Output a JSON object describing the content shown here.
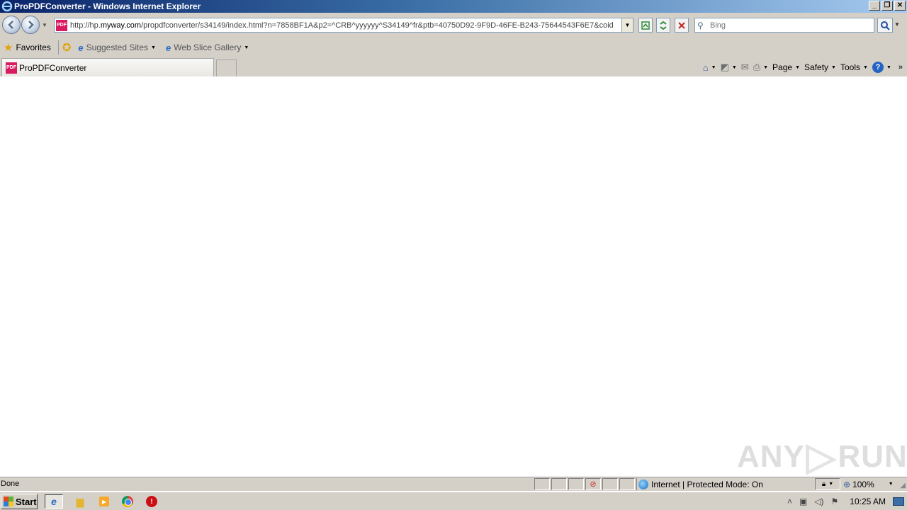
{
  "window": {
    "title": "ProPDFConverter - Windows Internet Explorer",
    "controls": [
      "minimize",
      "restore",
      "close"
    ]
  },
  "address_bar": {
    "url_prefix": "http://hp.",
    "url_domain": "myway.com",
    "url_rest": "/propdfconverter/s34149/index.html?n=7858BF1A&p2=^CRB^yyyyyy^S34149^fr&ptb=40750D92-9F9D-46FE-B243-75644543F6E7&coid"
  },
  "search": {
    "placeholder": "Bing"
  },
  "favorites_bar": {
    "favorites_label": "Favorites",
    "items": [
      {
        "label": "Suggested Sites"
      },
      {
        "label": "Web Slice Gallery"
      }
    ]
  },
  "tabs": {
    "active_label": "ProPDFConverter",
    "site_icon_text": "PDF"
  },
  "command_bar": {
    "page_label": "Page",
    "safety_label": "Safety",
    "tools_label": "Tools"
  },
  "status_bar": {
    "status_text": "Done",
    "zone_text": "Internet | Protected Mode: On",
    "zoom_text": "100%"
  },
  "taskbar": {
    "start_label": "Start",
    "clock": "10:25 AM"
  },
  "watermark": {
    "left": "ANY",
    "right": "RUN"
  }
}
